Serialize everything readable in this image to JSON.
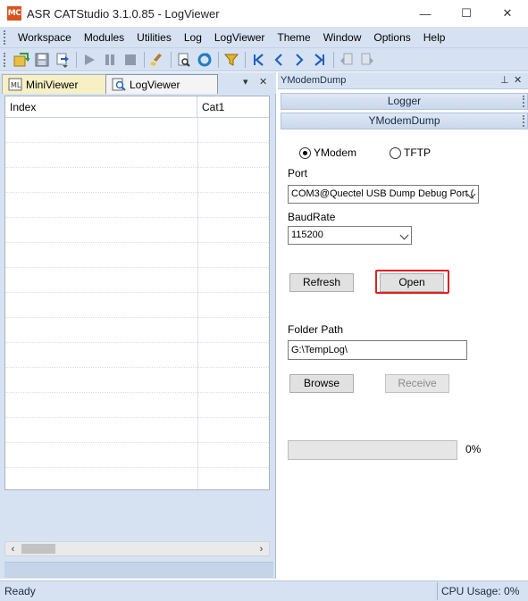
{
  "window": {
    "title": "ASR CATStudio 3.1.0.85 - LogViewer",
    "app_icon_text": "MC",
    "minimize": "—",
    "maximize": "☐",
    "close": "✕"
  },
  "menu": {
    "items": [
      "Workspace",
      "Modules",
      "Utilities",
      "Log",
      "LogViewer",
      "Theme",
      "Window",
      "Options",
      "Help"
    ]
  },
  "toolbar": {
    "buttons": [
      "open-icon",
      "save-icon",
      "export-icon",
      "play-icon",
      "pause-icon",
      "stop-icon",
      "clear-icon",
      "find-icon",
      "refresh-icon",
      "filter-icon",
      "first-icon",
      "prev-icon",
      "next-icon",
      "last-icon",
      "bookmark-prev-icon",
      "bookmark-next-icon"
    ]
  },
  "left_panel": {
    "tabs": [
      {
        "label": "MiniViewer"
      },
      {
        "label": "LogViewer"
      }
    ],
    "pin_glyph": "▾",
    "close_glyph": "✕",
    "columns": [
      "Index",
      "Cat1"
    ],
    "scroll_left": "‹",
    "scroll_right": "›"
  },
  "right_panel": {
    "title": "YModemDump",
    "pin_glyph": "⊥",
    "close_glyph": "✕",
    "section_logger": "Logger",
    "section_ymodem": "YModemDump",
    "protocol_options": [
      {
        "label": "YModem",
        "checked": true
      },
      {
        "label": "TFTP",
        "checked": false
      }
    ],
    "port_label": "Port",
    "port_value": "COM3@Quectel USB Dump Debug Port (",
    "baudrate_label": "BaudRate",
    "baudrate_value": "115200",
    "refresh_button": "Refresh",
    "open_button": "Open",
    "folder_path_label": "Folder Path",
    "folder_path_value": "G:\\TempLog\\",
    "browse_button": "Browse",
    "receive_button": "Receive",
    "progress_percent": 0,
    "progress_text": "0%"
  },
  "status": {
    "left": "Ready",
    "right": "CPU Usage:  0%"
  },
  "colors": {
    "chrome": "#d6e2f2",
    "highlight_border": "#e02020",
    "brand": "#d9531e"
  }
}
